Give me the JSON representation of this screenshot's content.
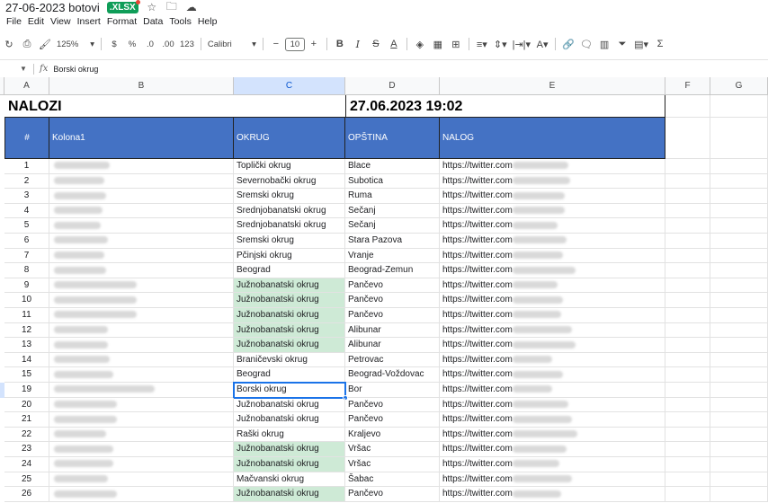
{
  "app": {
    "doc_title": "27-06-2023 botovi",
    "file_badge": ".XLSX",
    "menu": [
      "File",
      "Edit",
      "View",
      "Insert",
      "Format",
      "Data",
      "Tools",
      "Help"
    ]
  },
  "toolbar": {
    "zoom": "125%",
    "currency": "$",
    "percent": "%",
    "dec_decrease": ".0",
    "dec_increase": ".00",
    "number_format": "123",
    "font": "Calibri",
    "font_size": "10",
    "bold": "B",
    "italic": "I",
    "strike": "S",
    "text_color": "A",
    "sum": "Σ"
  },
  "formula": {
    "fx": "fx",
    "content": "Borski okrug"
  },
  "columns": [
    "A",
    "B",
    "C",
    "D",
    "E",
    "F",
    "G"
  ],
  "sheet": {
    "title_left": "NALOZI",
    "title_right": "27.06.2023 19:02",
    "headers": [
      "#",
      "Kolona1",
      "OKRUG",
      "OPŠTINA",
      "NALOG"
    ],
    "rows": [
      {
        "num": "1",
        "okrug": "Toplički okrug",
        "opstina": "Blace",
        "nalog": "https://twitter.com",
        "green": false
      },
      {
        "num": "2",
        "okrug": "Severnobački okrug",
        "opstina": "Subotica",
        "nalog": "https://twitter.com",
        "green": false
      },
      {
        "num": "3",
        "okrug": "Sremski okrug",
        "opstina": "Ruma",
        "nalog": "https://twitter.com",
        "green": false
      },
      {
        "num": "4",
        "okrug": "Srednjobanatski okrug",
        "opstina": "Sečanj",
        "nalog": "https://twitter.com",
        "green": false
      },
      {
        "num": "5",
        "okrug": "Srednjobanatski okrug",
        "opstina": "Sečanj",
        "nalog": "https://twitter.com",
        "green": false
      },
      {
        "num": "6",
        "okrug": "Sremski okrug",
        "opstina": "Stara Pazova",
        "nalog": "https://twitter.com",
        "green": false
      },
      {
        "num": "7",
        "okrug": "Pčinjski okrug",
        "opstina": "Vranje",
        "nalog": "https://twitter.com",
        "green": false
      },
      {
        "num": "8",
        "okrug": "Beograd",
        "opstina": "Beograd-Zemun",
        "nalog": "https://twitter.com",
        "green": false
      },
      {
        "num": "9",
        "okrug": "Južnobanatski okrug",
        "opstina": "Pančevo",
        "nalog": "https://twitter.com",
        "green": true
      },
      {
        "num": "10",
        "okrug": "Južnobanatski okrug",
        "opstina": "Pančevo",
        "nalog": "https://twitter.com",
        "green": true
      },
      {
        "num": "11",
        "okrug": "Južnobanatski okrug",
        "opstina": "Pančevo",
        "nalog": "https://twitter.com",
        "green": true
      },
      {
        "num": "12",
        "okrug": "Južnobanatski okrug",
        "opstina": "Alibunar",
        "nalog": "https://twitter.com",
        "green": true
      },
      {
        "num": "13",
        "okrug": "Južnobanatski okrug",
        "opstina": "Alibunar",
        "nalog": "https://twitter.com",
        "green": true
      },
      {
        "num": "14",
        "okrug": "Braničevski okrug",
        "opstina": "Petrovac",
        "nalog": "https://twitter.com",
        "green": false
      },
      {
        "num": "15",
        "okrug": "Beograd",
        "opstina": "Beograd-Voždovac",
        "nalog": "https://twitter.com",
        "green": false
      },
      {
        "num": "19",
        "okrug": "Borski okrug",
        "opstina": "Bor",
        "nalog": "https://twitter.com",
        "green": false,
        "selected": true
      },
      {
        "num": "20",
        "okrug": "Južnobanatski okrug",
        "opstina": "Pančevo",
        "nalog": "https://twitter.com",
        "green": false
      },
      {
        "num": "21",
        "okrug": "Južnobanatski okrug",
        "opstina": "Pančevo",
        "nalog": "https://twitter.com",
        "green": false
      },
      {
        "num": "22",
        "okrug": "Raški okrug",
        "opstina": "Kraljevo",
        "nalog": "https://twitter.com",
        "green": false
      },
      {
        "num": "23",
        "okrug": "Južnobanatski okrug",
        "opstina": "Vršac",
        "nalog": "https://twitter.com",
        "green": true
      },
      {
        "num": "24",
        "okrug": "Južnobanatski okrug",
        "opstina": "Vršac",
        "nalog": "https://twitter.com",
        "green": true
      },
      {
        "num": "25",
        "okrug": "Mačvanski okrug",
        "opstina": "Šabac",
        "nalog": "https://twitter.com",
        "green": false
      },
      {
        "num": "26",
        "okrug": "Južnobanatski okrug",
        "opstina": "Pančevo",
        "nalog": "https://twitter.com",
        "green": true
      }
    ]
  }
}
